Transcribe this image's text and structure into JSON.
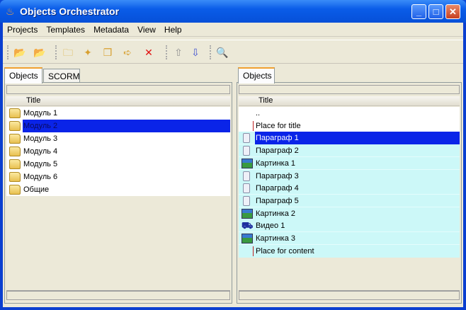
{
  "window": {
    "title": "Objects Orchestrator",
    "minimize": "_",
    "maximize": "□",
    "close": "✕"
  },
  "menu": [
    "Projects",
    "Templates",
    "Metadata",
    "View",
    "Help"
  ],
  "toolbar": [
    {
      "name": "open-project-icon",
      "glyph": "📂",
      "color": "#6a8a10"
    },
    {
      "name": "close-project-icon",
      "glyph": "📂",
      "color": "#6a8a10"
    },
    {
      "name": "new-folder-icon",
      "glyph": "🗀",
      "color": "#d8a830"
    },
    {
      "name": "new-object-icon",
      "glyph": "✦",
      "color": "#d8a030"
    },
    {
      "name": "copy-object-icon",
      "glyph": "❒",
      "color": "#d8a030"
    },
    {
      "name": "move-object-icon",
      "glyph": "➪",
      "color": "#d8a030"
    },
    {
      "name": "delete-icon",
      "glyph": "✕",
      "color": "#e01010"
    },
    {
      "name": "move-up-icon",
      "glyph": "⇧",
      "color": "#909090"
    },
    {
      "name": "move-down-icon",
      "glyph": "⇩",
      "color": "#4050d0"
    },
    {
      "name": "search-icon",
      "glyph": "🔍",
      "color": "#404040"
    }
  ],
  "left": {
    "tabs": [
      "Objects",
      "SCORM"
    ],
    "header": "Title",
    "items": [
      {
        "label": "Модуль 1"
      },
      {
        "label": "Модуль 2",
        "selected": true
      },
      {
        "label": "Модуль 3"
      },
      {
        "label": "Модуль 4"
      },
      {
        "label": "Модуль 5"
      },
      {
        "label": "Модуль 6"
      },
      {
        "label": "Общие"
      }
    ]
  },
  "right": {
    "tabs": [
      "Objects"
    ],
    "header": "Title",
    "items": [
      {
        "label": "..",
        "type": "up"
      },
      {
        "label": "Place for title",
        "type": "placeholder"
      },
      {
        "label": "Параграф 1",
        "type": "doc",
        "selected": true
      },
      {
        "label": "Параграф 2",
        "type": "doc"
      },
      {
        "label": "Картинка 1",
        "type": "pic"
      },
      {
        "label": "Параграф 3",
        "type": "doc"
      },
      {
        "label": "Параграф 4",
        "type": "doc"
      },
      {
        "label": "Параграф 5",
        "type": "doc"
      },
      {
        "label": "Картинка 2",
        "type": "pic"
      },
      {
        "label": "Видео 1",
        "type": "vid"
      },
      {
        "label": "Картинка 3",
        "type": "pic"
      },
      {
        "label": "Place for content",
        "type": "placeholder"
      }
    ]
  },
  "colors": {
    "selection": "#0a24e8",
    "content_bg": "#ccf8f8"
  }
}
